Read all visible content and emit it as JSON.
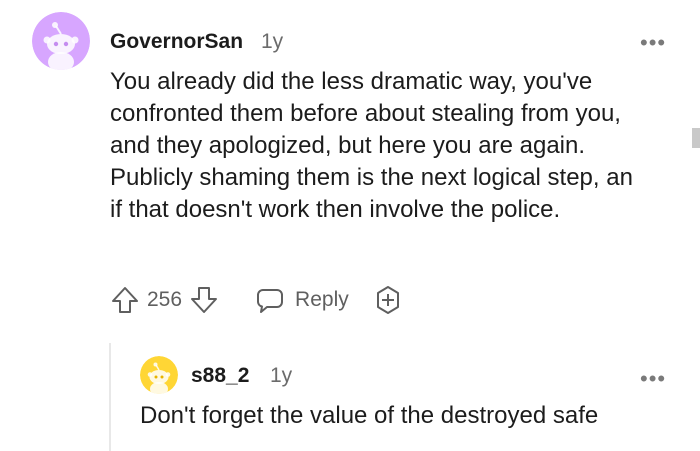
{
  "comment": {
    "username": "GovernorSan",
    "time": "1y",
    "body": "You already did the less dramatic way, you've confronted them before about stealing from you, and they apologized, but here you are again. Publicly shaming them is the next logical step, an if that doesn't work then involve the police.",
    "score": "256",
    "reply_label": "Reply",
    "avatar_color": "#d7a6ff"
  },
  "reply": {
    "username": "s88_2",
    "time": "1y",
    "body": "Don't forget the value of the destroyed safe",
    "avatar_color": "#ffd635"
  },
  "icons": {
    "more": "more-options-icon",
    "upvote": "upvote-icon",
    "downvote": "downvote-icon",
    "reply": "reply-bubble-icon",
    "award": "award-add-icon"
  }
}
